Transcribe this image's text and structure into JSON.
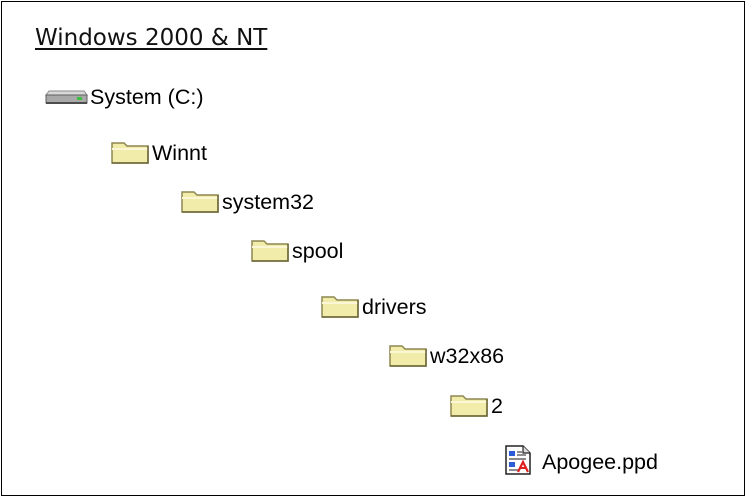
{
  "heading": "Windows 2000 & NT",
  "tree": {
    "drive": {
      "label": "System (C:)",
      "icon": "hard-drive-icon"
    },
    "folders": [
      {
        "label": "Winnt",
        "icon": "folder-icon"
      },
      {
        "label": "system32",
        "icon": "folder-icon"
      },
      {
        "label": "spool",
        "icon": "folder-icon"
      },
      {
        "label": "drivers",
        "icon": "folder-icon"
      },
      {
        "label": "w32x86",
        "icon": "folder-icon"
      },
      {
        "label": "2",
        "icon": "folder-icon"
      }
    ],
    "file": {
      "label": "Apogee.ppd",
      "icon": "ppd-file-icon"
    }
  },
  "colors": {
    "folder_fill": "#f2ecaa",
    "folder_outline": "#8d8750",
    "border": "#000000"
  }
}
